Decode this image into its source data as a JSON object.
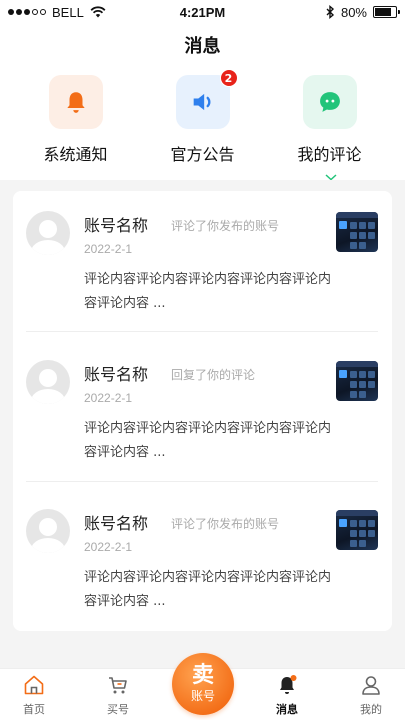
{
  "status_bar": {
    "carrier": "BELL",
    "time": "4:21PM",
    "battery": "80%",
    "battery_level": 0.8
  },
  "page": {
    "title": "消息"
  },
  "categories": [
    {
      "label": "系统通知",
      "icon": "bell-icon",
      "color": "#fdeee5",
      "icon_color": "#f36d17"
    },
    {
      "label": "官方公告",
      "icon": "speaker-icon",
      "color": "#e7f1fd",
      "icon_color": "#2f80ed",
      "badge": "2"
    },
    {
      "label": "我的评论",
      "icon": "chat-bubble-icon",
      "color": "#e5f7ef",
      "icon_color": "#22c47a"
    }
  ],
  "comments": [
    {
      "name": "账号名称",
      "action": "评论了你发布的账号",
      "date": "2022-2-1",
      "text": "评论内容评论内容评论内容评论内容评论内容评论内容 ..."
    },
    {
      "name": "账号名称",
      "action": "回复了你的评论",
      "date": "2022-2-1",
      "text": "评论内容评论内容评论内容评论内容评论内容评论内容 ..."
    },
    {
      "name": "账号名称",
      "action": "评论了你发布的账号",
      "date": "2022-2-1",
      "text": "评论内容评论内容评论内容评论内容评论内容评论内容 ..."
    }
  ],
  "tab_bar": {
    "home": "首页",
    "buy": "买号",
    "sell_main": "卖",
    "sell_sub": "账号",
    "messages": "消息",
    "mine": "我的"
  },
  "colors": {
    "accent": "#f36d17",
    "badge": "#e8231a"
  }
}
